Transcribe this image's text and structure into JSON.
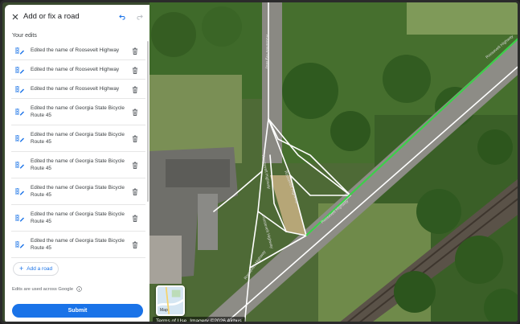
{
  "panel": {
    "title": "Add or fix a road",
    "section_label": "Your edits",
    "edits": [
      {
        "text": "Edited the name of Roosevelt Highway"
      },
      {
        "text": "Edited the name of Roosevelt Highway"
      },
      {
        "text": "Edited the name of Roosevelt Highway"
      },
      {
        "text": "Edited the name of Georgia State Bicycle Route 45"
      },
      {
        "text": "Edited the name of Georgia State Bicycle Route 45"
      },
      {
        "text": "Edited the name of Georgia State Bicycle Route 45"
      },
      {
        "text": "Edited the name of Georgia State Bicycle Route 45"
      },
      {
        "text": "Edited the name of Georgia State Bicycle Route 45"
      },
      {
        "text": "Edited the name of Georgia State Bicycle Route 45"
      }
    ],
    "add_road_label": "Add a road",
    "note": "Edits are used across Google",
    "submit_label": "Submit"
  },
  "map": {
    "road_labels": [
      "Roosevelt Highway",
      "Roosevelt Highway",
      "Roosevelt Highway",
      "Roosevelt Highway",
      "Roosevelt Highway",
      "Roosevelt Highway",
      "Roosevelt Highway"
    ],
    "layer_label": "Map",
    "attribution": {
      "terms": "Terms of Use",
      "imagery": "Imagery ©2026 Airbus"
    }
  },
  "colors": {
    "accent": "#1a73e8",
    "highlight_route": "#3cd04a",
    "road_outline": "#ffffff"
  },
  "icons": [
    "close-icon",
    "undo-icon",
    "redo-icon",
    "edit-road-icon",
    "delete-icon",
    "plus-icon",
    "info-icon"
  ]
}
